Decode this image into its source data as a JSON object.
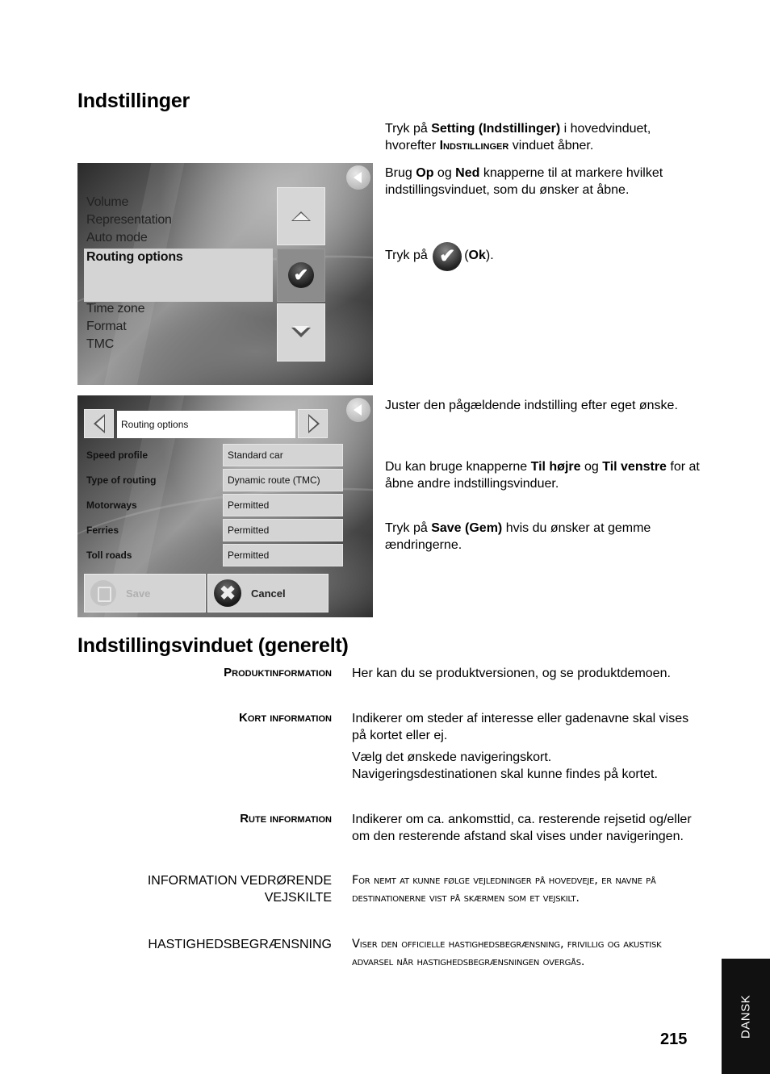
{
  "section1": {
    "title": "Indstillinger",
    "paragraphs": {
      "p1_a": "Tryk på ",
      "p1_b": "Setting (Indstillinger)",
      "p1_c": " i hovedvinduet, hvorefter ",
      "p1_d": "Indstillinger",
      "p1_e": " vinduet åbner.",
      "p2_a": "Brug ",
      "p2_b": "Op",
      "p2_c": " og ",
      "p2_d": "Ned",
      "p2_e": " knapperne til at markere hvilket indstillingsvinduet, som du ønsker at åbne.",
      "p3_a": "Tryk på",
      "p3_b": "(",
      "p3_c": "Ok",
      "p3_d": ").",
      "p4": "Juster den pågældende indstilling efter eget ønske.",
      "p5_a": "Du kan bruge knapperne ",
      "p5_b": "Til højre",
      "p5_c": " og ",
      "p5_d": "Til venstre",
      "p5_e": " for at åbne andre indstillingsvinduer.",
      "p6_a": "Tryk på ",
      "p6_b": "Save (Gem)",
      "p6_c": " hvis du ønsker at gemme ændringerne."
    }
  },
  "screenshot1": {
    "menu_items": [
      "Volume",
      "Representation",
      "Auto mode",
      "Routing options",
      "Time zone",
      "Format",
      "TMC"
    ],
    "selected_index": 3,
    "icons": {
      "back": "back-arrow-icon",
      "up": "up-arrow-icon",
      "ok": "checkmark-icon",
      "down": "down-arrow-icon"
    },
    "ok_glyph": "✔"
  },
  "screenshot2": {
    "window_title": "Routing options",
    "options": [
      {
        "label": "Speed profile",
        "value": "Standard car"
      },
      {
        "label": "Type of routing",
        "value": "Dynamic route (TMC)"
      },
      {
        "label": "Motorways",
        "value": "Permitted"
      },
      {
        "label": "Ferries",
        "value": "Permitted"
      },
      {
        "label": "Toll roads",
        "value": "Permitted"
      }
    ],
    "save_label": "Save",
    "cancel_label": "Cancel",
    "cancel_glyph": "✖"
  },
  "section2": {
    "title": "Indstillingsvinduet (generelt)",
    "entries": [
      {
        "term": "Produktinformation",
        "desc": [
          "Her kan du se produktversionen, og se produktdemoen."
        ]
      },
      {
        "term": "Kort information",
        "desc": [
          "Indikerer om steder af interesse eller gadenavne skal vises på kortet eller ej.",
          "Vælg det ønskede navigeringskort. Navigeringsdestinationen skal kunne findes på kortet."
        ]
      },
      {
        "term": "Rute information",
        "desc": [
          "Indikerer om ca. ankomsttid, ca. resterende rejsetid og/eller om den resterende afstand skal vises under navigeringen."
        ]
      },
      {
        "term": "INFORMATION VEDRØRENDE VEJSKILTE",
        "desc": [
          "For nemt at kunne følge vejledninger på hovedveje, er navne på destinationerne vist på skærmen som et vejskilt."
        ]
      },
      {
        "term": "HASTIGHEDSBEGRÆNSNING",
        "desc": [
          "Viser den officielle hastighedsbegrænsning, frivillig og akustisk advarsel når hastighedsbegrænsningen overgås."
        ]
      }
    ]
  },
  "footer": {
    "page_number": "215",
    "language_tab": "DANSK"
  }
}
